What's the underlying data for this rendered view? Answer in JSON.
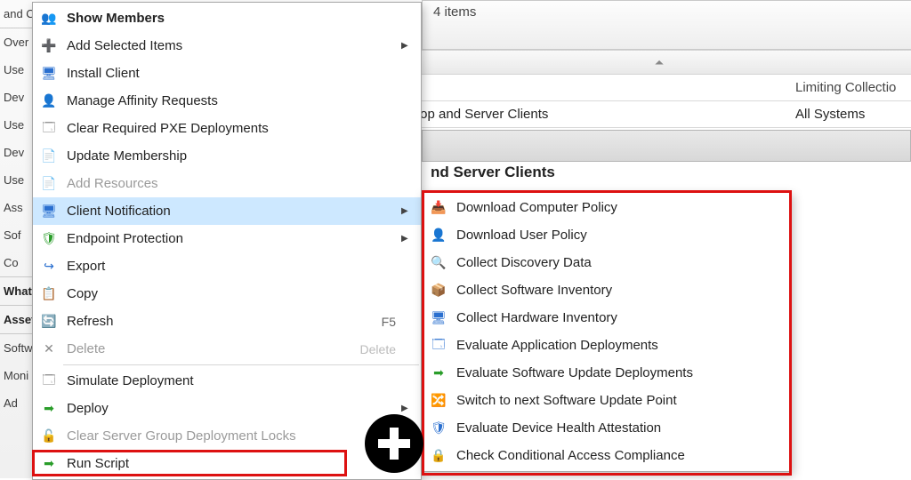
{
  "background_sidebar": {
    "items": [
      "and C",
      "Over",
      "Use",
      "Dev",
      "Use",
      "Dev",
      "Use",
      "Ass",
      "Sof",
      "Co"
    ],
    "what_label": "What",
    "asset_label": "Asset",
    "softw_label": "Softw",
    "moni_label": "Moni",
    "ad_label": "Ad"
  },
  "topbar": {
    "items_count_label": "4 items"
  },
  "detail": {
    "collection_header": "Limiting Collectio",
    "row_left": "top and Server Clients",
    "row_right": "All Systems",
    "subtitle": "nd Server Clients",
    "subtitle_inbar": ""
  },
  "context_menu": {
    "items": [
      {
        "icon": "members-icon",
        "glyph": "👥",
        "label": "Show Members",
        "bold": true
      },
      {
        "icon": "add-icon",
        "glyph": "➕",
        "cls": "i-green",
        "label": "Add Selected Items",
        "submenu": true
      },
      {
        "icon": "install-icon",
        "glyph": "🖥",
        "cls": "i-blue",
        "label": "Install Client"
      },
      {
        "icon": "affinity-icon",
        "glyph": "👤",
        "cls": "i-orange",
        "label": "Manage Affinity Requests"
      },
      {
        "icon": "clear-pxe-icon",
        "glyph": "🗔",
        "cls": "i-grey",
        "label": "Clear Required PXE Deployments"
      },
      {
        "icon": "update-icon",
        "glyph": "📄",
        "cls": "i-orange",
        "label": "Update Membership"
      },
      {
        "icon": "add-res-icon",
        "glyph": "📄",
        "cls": "i-grey",
        "label": "Add Resources",
        "disabled": true
      },
      {
        "icon": "client-notif-icon",
        "glyph": "🖥",
        "cls": "i-blue",
        "label": "Client Notification",
        "submenu": true,
        "hover": true
      },
      {
        "icon": "endpoint-icon",
        "glyph": "🛡",
        "cls": "i-green",
        "label": "Endpoint Protection",
        "submenu": true
      },
      {
        "icon": "export-icon",
        "glyph": "↪",
        "cls": "i-blue",
        "label": "Export"
      },
      {
        "icon": "copy-icon",
        "glyph": "📋",
        "cls": "i-grey",
        "label": "Copy"
      },
      {
        "icon": "refresh-icon",
        "glyph": "🔄",
        "cls": "i-green",
        "label": "Refresh",
        "shortcut": "F5"
      },
      {
        "icon": "delete-icon",
        "glyph": "✕",
        "cls": "i-grey",
        "label": "Delete",
        "shortcut": "Delete",
        "disabled": true
      },
      {
        "sep": true
      },
      {
        "icon": "simulate-icon",
        "glyph": "🗔",
        "cls": "i-grey",
        "label": "Simulate Deployment"
      },
      {
        "icon": "deploy-icon",
        "glyph": "➡",
        "cls": "i-green",
        "label": "Deploy",
        "submenu": true
      },
      {
        "icon": "clear-lock-icon",
        "glyph": "🔓",
        "cls": "i-grey",
        "label": "Clear Server Group Deployment Locks",
        "disabled": true
      },
      {
        "icon": "run-script-icon",
        "glyph": "➡",
        "cls": "i-green",
        "label": "Run Script"
      }
    ]
  },
  "submenu": {
    "items": [
      {
        "icon": "download-policy-icon",
        "glyph": "📥",
        "cls": "i-orange",
        "label": "Download Computer Policy"
      },
      {
        "icon": "download-user-policy-icon",
        "glyph": "👤",
        "cls": "i-blue",
        "label": "Download User Policy"
      },
      {
        "icon": "discovery-icon",
        "glyph": "🔍",
        "cls": "i-blue",
        "label": "Collect Discovery Data"
      },
      {
        "icon": "sw-inventory-icon",
        "glyph": "📦",
        "cls": "i-teal",
        "label": "Collect Software Inventory"
      },
      {
        "icon": "hw-inventory-icon",
        "glyph": "🖥",
        "cls": "i-blue",
        "label": "Collect Hardware Inventory"
      },
      {
        "icon": "eval-app-icon",
        "glyph": "🗔",
        "cls": "i-blue",
        "label": "Evaluate Application Deployments"
      },
      {
        "icon": "eval-su-icon",
        "glyph": "➡",
        "cls": "i-green",
        "label": "Evaluate Software Update Deployments"
      },
      {
        "icon": "switch-sup-icon",
        "glyph": "🔀",
        "cls": "i-blue",
        "label": "Switch to next Software Update Point"
      },
      {
        "icon": "device-health-icon",
        "glyph": "🛡",
        "cls": "i-blue",
        "label": "Evaluate Device Health Attestation"
      },
      {
        "icon": "conditional-access-icon",
        "glyph": "🔒",
        "cls": "i-orange",
        "label": "Check Conditional Access Compliance"
      }
    ]
  }
}
